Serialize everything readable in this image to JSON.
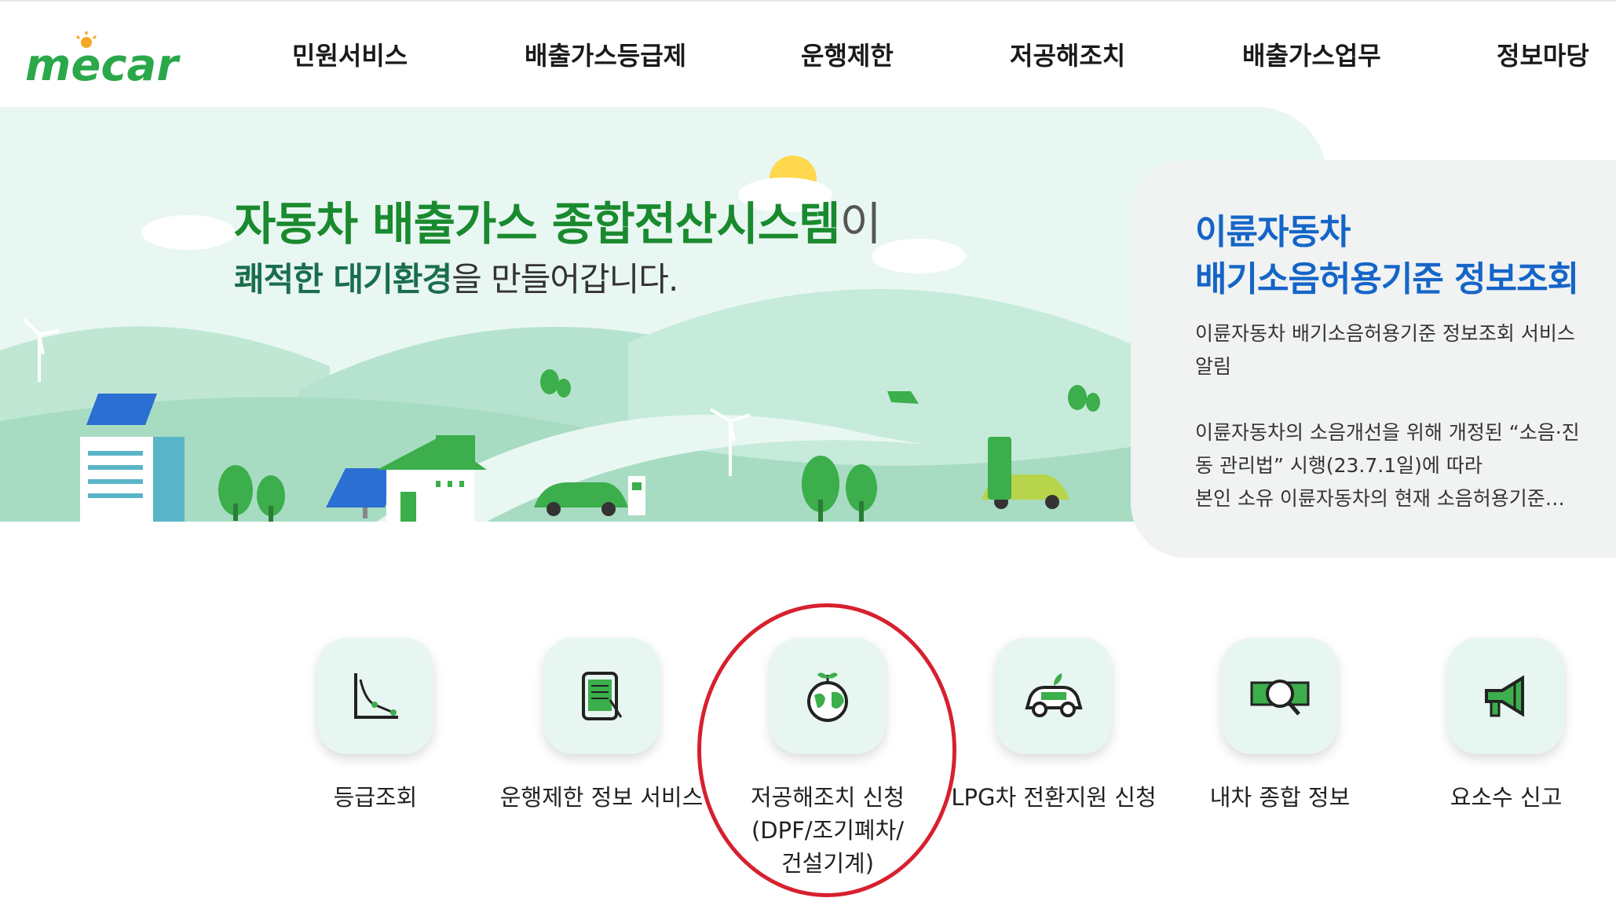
{
  "header": {
    "logo_text": "mecar",
    "nav": [
      {
        "label": "민원서비스"
      },
      {
        "label": "배출가스등급제"
      },
      {
        "label": "운행제한"
      },
      {
        "label": "저공해조치"
      },
      {
        "label": "배출가스업무"
      },
      {
        "label": "정보마당"
      }
    ]
  },
  "hero": {
    "title_bold": "자동차 배출가스 종합전산시스템",
    "title_suffix": "이",
    "sub_highlight": "쾌적한 대기환경",
    "sub_rest": "을 만들어갑니다."
  },
  "notice": {
    "title_line1": "이륜자동차",
    "title_line2": "배기소음허용기준 정보조회",
    "line1": "이륜자동차 배기소음허용기준 정보조회 서비스 알림",
    "line2": "이륜자동차의 소음개선을 위해 개정된 “소음·진동 관리법” 시행(23.7.1일)에 따라",
    "line3": "본인 소유 이륜자동차의 현재 소음허용기준…"
  },
  "quick_menu": [
    {
      "label": "등급조회",
      "icon": "grade-chart-icon"
    },
    {
      "label": "운행제한 정보 서비스",
      "icon": "tablet-document-icon"
    },
    {
      "label": "저공해조치 신청",
      "label2": "(DPF/조기폐차/",
      "label3": "건설기계)",
      "icon": "earth-sprout-icon"
    },
    {
      "label": "LPG차 전환지원 신청",
      "icon": "eco-car-icon"
    },
    {
      "label": "내차 종합 정보",
      "icon": "search-money-icon"
    },
    {
      "label": "요소수 신고",
      "icon": "megaphone-icon"
    }
  ],
  "colors": {
    "brand_green": "#1a8a2e",
    "notice_blue": "#1565c8",
    "highlight_circle": "#d7202e"
  }
}
